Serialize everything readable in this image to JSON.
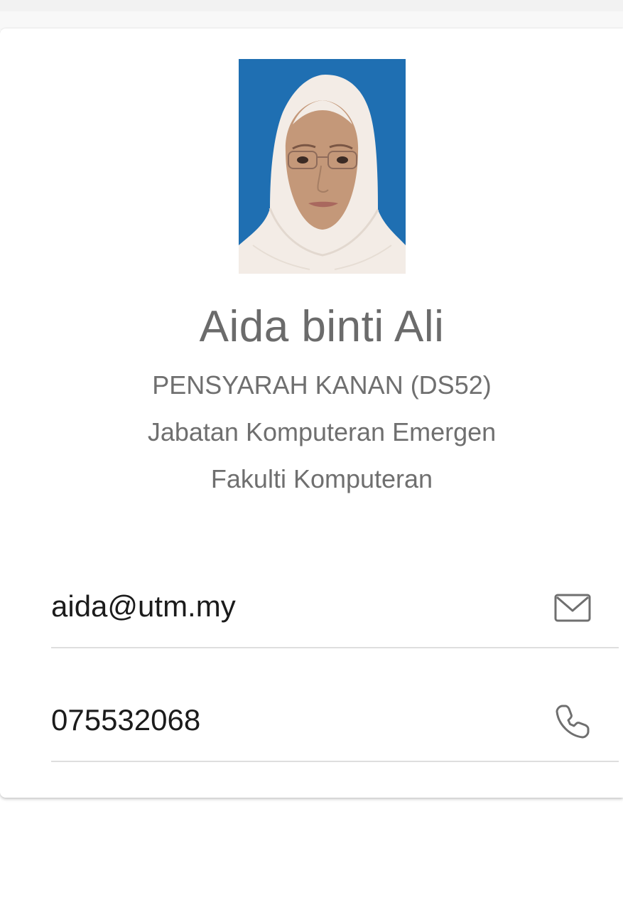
{
  "profile": {
    "name": "Aida binti Ali",
    "position": "PENSYARAH KANAN (DS52)",
    "department": "Jabatan Komputeran Emergen",
    "faculty": "Fakulti Komputeran"
  },
  "contacts": {
    "email": "aida@utm.my",
    "phone": "075532068"
  },
  "icons": {
    "email": "mail-icon",
    "phone": "phone-icon"
  },
  "colors": {
    "photo_background": "#1f6fb2",
    "text_gray": "#6b6b6b",
    "divider": "#dedede"
  }
}
